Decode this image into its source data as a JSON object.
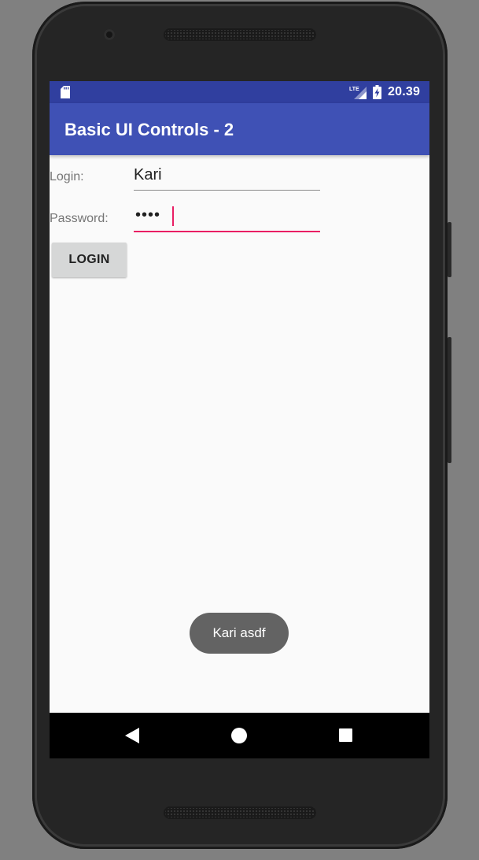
{
  "status_bar": {
    "time": "20.39",
    "network": "LTE",
    "icons": [
      "sd-card-icon",
      "lte-signal-icon",
      "battery-charging-icon"
    ]
  },
  "app_bar": {
    "title": "Basic UI Controls - 2",
    "color": "#3f51b5",
    "status_color": "#303f9f"
  },
  "form": {
    "login_label": "Login:",
    "login_value": "Kari",
    "password_label": "Password:",
    "password_masked": "••••",
    "accent_color": "#e91e63"
  },
  "login_button": {
    "label": "LOGIN"
  },
  "toast": {
    "message": "Kari asdf"
  },
  "nav_bar": {
    "icons": [
      "back-icon",
      "home-icon",
      "recents-icon"
    ]
  }
}
